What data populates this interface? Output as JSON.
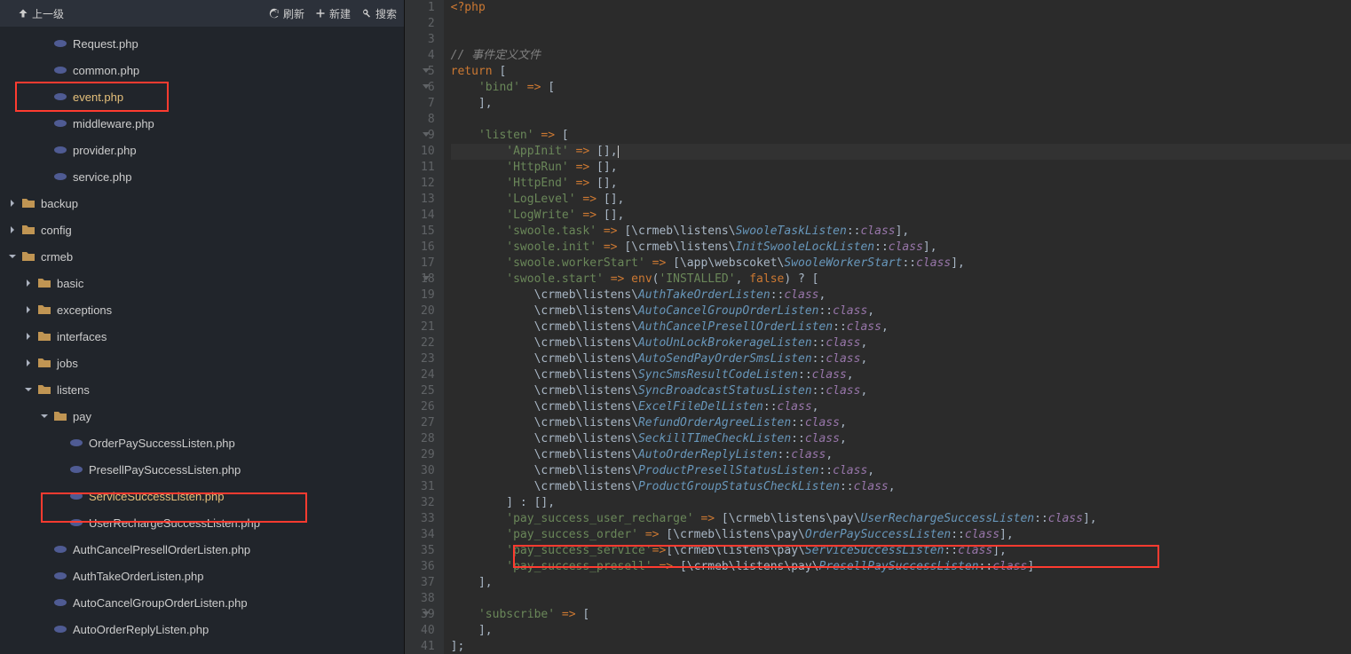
{
  "toolbar": {
    "up": "上一级",
    "refresh": "刷新",
    "new": "新建",
    "search": "搜索"
  },
  "tree": [
    {
      "kind": "file",
      "depth": 2,
      "name": "Request.php",
      "icon": "php"
    },
    {
      "kind": "file",
      "depth": 2,
      "name": "common.php",
      "icon": "php"
    },
    {
      "kind": "file",
      "depth": 2,
      "name": "event.php",
      "icon": "php",
      "active": true
    },
    {
      "kind": "file",
      "depth": 2,
      "name": "middleware.php",
      "icon": "php"
    },
    {
      "kind": "file",
      "depth": 2,
      "name": "provider.php",
      "icon": "php"
    },
    {
      "kind": "file",
      "depth": 2,
      "name": "service.php",
      "icon": "php"
    },
    {
      "kind": "folder",
      "depth": 0,
      "name": "backup",
      "open": false
    },
    {
      "kind": "folder",
      "depth": 0,
      "name": "config",
      "open": false
    },
    {
      "kind": "folder",
      "depth": 0,
      "name": "crmeb",
      "open": true
    },
    {
      "kind": "folder",
      "depth": 1,
      "name": "basic",
      "open": false
    },
    {
      "kind": "folder",
      "depth": 1,
      "name": "exceptions",
      "open": false
    },
    {
      "kind": "folder",
      "depth": 1,
      "name": "interfaces",
      "open": false
    },
    {
      "kind": "folder",
      "depth": 1,
      "name": "jobs",
      "open": false
    },
    {
      "kind": "folder",
      "depth": 1,
      "name": "listens",
      "open": true
    },
    {
      "kind": "folder",
      "depth": 2,
      "name": "pay",
      "open": true
    },
    {
      "kind": "file",
      "depth": 3,
      "name": "OrderPaySuccessListen.php",
      "icon": "php"
    },
    {
      "kind": "file",
      "depth": 3,
      "name": "PresellPaySuccessListen.php",
      "icon": "php"
    },
    {
      "kind": "file",
      "depth": 3,
      "name": "ServiceSuccessListen.php",
      "icon": "php",
      "active": true
    },
    {
      "kind": "file",
      "depth": 3,
      "name": "UserRechargeSuccessListen.php",
      "icon": "php"
    },
    {
      "kind": "file",
      "depth": 2,
      "name": "AuthCancelPresellOrderListen.php",
      "icon": "php"
    },
    {
      "kind": "file",
      "depth": 2,
      "name": "AuthTakeOrderListen.php",
      "icon": "php"
    },
    {
      "kind": "file",
      "depth": 2,
      "name": "AutoCancelGroupOrderListen.php",
      "icon": "php"
    },
    {
      "kind": "file",
      "depth": 2,
      "name": "AutoOrderReplyListen.php",
      "icon": "php"
    }
  ],
  "code": {
    "lines": [
      {
        "n": 1,
        "tokens": [
          [
            "kw",
            "<?php"
          ]
        ]
      },
      {
        "n": 2,
        "tokens": []
      },
      {
        "n": 3,
        "tokens": []
      },
      {
        "n": 4,
        "tokens": [
          [
            "comment",
            "// 事件定义文件"
          ]
        ]
      },
      {
        "n": 5,
        "fold": true,
        "tokens": [
          [
            "kw",
            "return"
          ],
          [
            "p",
            " ["
          ]
        ]
      },
      {
        "n": 6,
        "fold": true,
        "tokens": [
          [
            "p",
            "    "
          ],
          [
            "str",
            "'bind'"
          ],
          [
            "p",
            " "
          ],
          [
            "op",
            "=>"
          ],
          [
            "p",
            " ["
          ]
        ]
      },
      {
        "n": 7,
        "tokens": [
          [
            "p",
            "    ],"
          ]
        ]
      },
      {
        "n": 8,
        "tokens": []
      },
      {
        "n": 9,
        "fold": true,
        "tokens": [
          [
            "p",
            "    "
          ],
          [
            "str",
            "'listen'"
          ],
          [
            "p",
            " "
          ],
          [
            "op",
            "=>"
          ],
          [
            "p",
            " ["
          ]
        ]
      },
      {
        "n": 10,
        "hl": true,
        "tokens": [
          [
            "p",
            "        "
          ],
          [
            "str",
            "'AppInit'"
          ],
          [
            "p",
            " "
          ],
          [
            "op",
            "=>"
          ],
          [
            "p",
            " [],"
          ],
          [
            "cursor",
            ""
          ]
        ]
      },
      {
        "n": 11,
        "tokens": [
          [
            "p",
            "        "
          ],
          [
            "str",
            "'HttpRun'"
          ],
          [
            "p",
            " "
          ],
          [
            "op",
            "=>"
          ],
          [
            "p",
            " [],"
          ]
        ]
      },
      {
        "n": 12,
        "tokens": [
          [
            "p",
            "        "
          ],
          [
            "str",
            "'HttpEnd'"
          ],
          [
            "p",
            " "
          ],
          [
            "op",
            "=>"
          ],
          [
            "p",
            " [],"
          ]
        ]
      },
      {
        "n": 13,
        "tokens": [
          [
            "p",
            "        "
          ],
          [
            "str",
            "'LogLevel'"
          ],
          [
            "p",
            " "
          ],
          [
            "op",
            "=>"
          ],
          [
            "p",
            " [],"
          ]
        ]
      },
      {
        "n": 14,
        "tokens": [
          [
            "p",
            "        "
          ],
          [
            "str",
            "'LogWrite'"
          ],
          [
            "p",
            " "
          ],
          [
            "op",
            "=>"
          ],
          [
            "p",
            " [],"
          ]
        ]
      },
      {
        "n": 15,
        "tokens": [
          [
            "p",
            "        "
          ],
          [
            "str",
            "'swoole.task'"
          ],
          [
            "p",
            " "
          ],
          [
            "op",
            "=>"
          ],
          [
            "p",
            " [\\crmeb\\listens\\"
          ],
          [
            "class",
            "SwooleTaskListen"
          ],
          [
            "p",
            "::"
          ],
          [
            "const",
            "class"
          ],
          [
            "p",
            "],"
          ]
        ]
      },
      {
        "n": 16,
        "tokens": [
          [
            "p",
            "        "
          ],
          [
            "str",
            "'swoole.init'"
          ],
          [
            "p",
            " "
          ],
          [
            "op",
            "=>"
          ],
          [
            "p",
            " [\\crmeb\\listens\\"
          ],
          [
            "class",
            "InitSwooleLockListen"
          ],
          [
            "p",
            "::"
          ],
          [
            "const",
            "class"
          ],
          [
            "p",
            "],"
          ]
        ]
      },
      {
        "n": 17,
        "tokens": [
          [
            "p",
            "        "
          ],
          [
            "str",
            "'swoole.workerStart'"
          ],
          [
            "p",
            " "
          ],
          [
            "op",
            "=>"
          ],
          [
            "p",
            " [\\app\\webscoket\\"
          ],
          [
            "class",
            "SwooleWorkerStart"
          ],
          [
            "p",
            "::"
          ],
          [
            "const",
            "class"
          ],
          [
            "p",
            "],"
          ]
        ]
      },
      {
        "n": 18,
        "fold": true,
        "tokens": [
          [
            "p",
            "        "
          ],
          [
            "str",
            "'swoole.start'"
          ],
          [
            "p",
            " "
          ],
          [
            "op",
            "=>"
          ],
          [
            "p",
            " "
          ],
          [
            "builtin",
            "env"
          ],
          [
            "p",
            "("
          ],
          [
            "str",
            "'INSTALLED'"
          ],
          [
            "p",
            ", "
          ],
          [
            "kw",
            "false"
          ],
          [
            "p",
            ") ? ["
          ]
        ]
      },
      {
        "n": 19,
        "tokens": [
          [
            "p",
            "            \\crmeb\\listens\\"
          ],
          [
            "class",
            "AuthTakeOrderListen"
          ],
          [
            "p",
            "::"
          ],
          [
            "const",
            "class"
          ],
          [
            "p",
            ","
          ]
        ]
      },
      {
        "n": 20,
        "tokens": [
          [
            "p",
            "            \\crmeb\\listens\\"
          ],
          [
            "class",
            "AutoCancelGroupOrderListen"
          ],
          [
            "p",
            "::"
          ],
          [
            "const",
            "class"
          ],
          [
            "p",
            ","
          ]
        ]
      },
      {
        "n": 21,
        "tokens": [
          [
            "p",
            "            \\crmeb\\listens\\"
          ],
          [
            "class",
            "AuthCancelPresellOrderListen"
          ],
          [
            "p",
            "::"
          ],
          [
            "const",
            "class"
          ],
          [
            "p",
            ","
          ]
        ]
      },
      {
        "n": 22,
        "tokens": [
          [
            "p",
            "            \\crmeb\\listens\\"
          ],
          [
            "class",
            "AutoUnLockBrokerageListen"
          ],
          [
            "p",
            "::"
          ],
          [
            "const",
            "class"
          ],
          [
            "p",
            ","
          ]
        ]
      },
      {
        "n": 23,
        "tokens": [
          [
            "p",
            "            \\crmeb\\listens\\"
          ],
          [
            "class",
            "AutoSendPayOrderSmsListen"
          ],
          [
            "p",
            "::"
          ],
          [
            "const",
            "class"
          ],
          [
            "p",
            ","
          ]
        ]
      },
      {
        "n": 24,
        "tokens": [
          [
            "p",
            "            \\crmeb\\listens\\"
          ],
          [
            "class",
            "SyncSmsResultCodeListen"
          ],
          [
            "p",
            "::"
          ],
          [
            "const",
            "class"
          ],
          [
            "p",
            ","
          ]
        ]
      },
      {
        "n": 25,
        "tokens": [
          [
            "p",
            "            \\crmeb\\listens\\"
          ],
          [
            "class",
            "SyncBroadcastStatusListen"
          ],
          [
            "p",
            "::"
          ],
          [
            "const",
            "class"
          ],
          [
            "p",
            ","
          ]
        ]
      },
      {
        "n": 26,
        "tokens": [
          [
            "p",
            "            \\crmeb\\listens\\"
          ],
          [
            "class",
            "ExcelFileDelListen"
          ],
          [
            "p",
            "::"
          ],
          [
            "const",
            "class"
          ],
          [
            "p",
            ","
          ]
        ]
      },
      {
        "n": 27,
        "tokens": [
          [
            "p",
            "            \\crmeb\\listens\\"
          ],
          [
            "class",
            "RefundOrderAgreeListen"
          ],
          [
            "p",
            "::"
          ],
          [
            "const",
            "class"
          ],
          [
            "p",
            ","
          ]
        ]
      },
      {
        "n": 28,
        "tokens": [
          [
            "p",
            "            \\crmeb\\listens\\"
          ],
          [
            "class",
            "SeckillTImeCheckListen"
          ],
          [
            "p",
            "::"
          ],
          [
            "const",
            "class"
          ],
          [
            "p",
            ","
          ]
        ]
      },
      {
        "n": 29,
        "tokens": [
          [
            "p",
            "            \\crmeb\\listens\\"
          ],
          [
            "class",
            "AutoOrderReplyListen"
          ],
          [
            "p",
            "::"
          ],
          [
            "const",
            "class"
          ],
          [
            "p",
            ","
          ]
        ]
      },
      {
        "n": 30,
        "tokens": [
          [
            "p",
            "            \\crmeb\\listens\\"
          ],
          [
            "class",
            "ProductPresellStatusListen"
          ],
          [
            "p",
            "::"
          ],
          [
            "const",
            "class"
          ],
          [
            "p",
            ","
          ]
        ]
      },
      {
        "n": 31,
        "tokens": [
          [
            "p",
            "            \\crmeb\\listens\\"
          ],
          [
            "class",
            "ProductGroupStatusCheckListen"
          ],
          [
            "p",
            "::"
          ],
          [
            "const",
            "class"
          ],
          [
            "p",
            ","
          ]
        ]
      },
      {
        "n": 32,
        "tokens": [
          [
            "p",
            "        ] : [],"
          ]
        ]
      },
      {
        "n": 33,
        "tokens": [
          [
            "p",
            "        "
          ],
          [
            "str",
            "'pay_success_user_recharge'"
          ],
          [
            "p",
            " "
          ],
          [
            "op",
            "=>"
          ],
          [
            "p",
            " [\\crmeb\\listens\\pay\\"
          ],
          [
            "class",
            "UserRechargeSuccessListen"
          ],
          [
            "p",
            "::"
          ],
          [
            "const",
            "class"
          ],
          [
            "p",
            "],"
          ]
        ]
      },
      {
        "n": 34,
        "tokens": [
          [
            "p",
            "        "
          ],
          [
            "str",
            "'pay_success_order'"
          ],
          [
            "p",
            " "
          ],
          [
            "op",
            "=>"
          ],
          [
            "p",
            " [\\crmeb\\listens\\pay\\"
          ],
          [
            "class",
            "OrderPaySuccessListen"
          ],
          [
            "p",
            "::"
          ],
          [
            "const",
            "class"
          ],
          [
            "p",
            "],"
          ]
        ]
      },
      {
        "n": 35,
        "tokens": [
          [
            "p",
            "        "
          ],
          [
            "str",
            "'pay_success_service'"
          ],
          [
            "op",
            "=>"
          ],
          [
            "p",
            "[\\crmeb\\listens\\pay\\"
          ],
          [
            "class",
            "ServiceSuccessListen"
          ],
          [
            "p",
            "::"
          ],
          [
            "const",
            "class"
          ],
          [
            "p",
            "],"
          ]
        ]
      },
      {
        "n": 36,
        "tokens": [
          [
            "p",
            "        "
          ],
          [
            "str",
            "'pay_success_presell'"
          ],
          [
            "p",
            " "
          ],
          [
            "op",
            "=>"
          ],
          [
            "p",
            " [\\crmeb\\listens\\pay\\"
          ],
          [
            "class",
            "PresellPaySuccessListen"
          ],
          [
            "p",
            "::"
          ],
          [
            "const",
            "class"
          ],
          [
            "p",
            "]"
          ]
        ]
      },
      {
        "n": 37,
        "tokens": [
          [
            "p",
            "    ],"
          ]
        ]
      },
      {
        "n": 38,
        "tokens": []
      },
      {
        "n": 39,
        "fold": true,
        "tokens": [
          [
            "p",
            "    "
          ],
          [
            "str",
            "'subscribe'"
          ],
          [
            "p",
            " "
          ],
          [
            "op",
            "=>"
          ],
          [
            "p",
            " ["
          ]
        ]
      },
      {
        "n": 40,
        "tokens": [
          [
            "p",
            "    ],"
          ]
        ]
      },
      {
        "n": 41,
        "tokens": [
          [
            "p",
            "];"
          ]
        ]
      }
    ]
  }
}
